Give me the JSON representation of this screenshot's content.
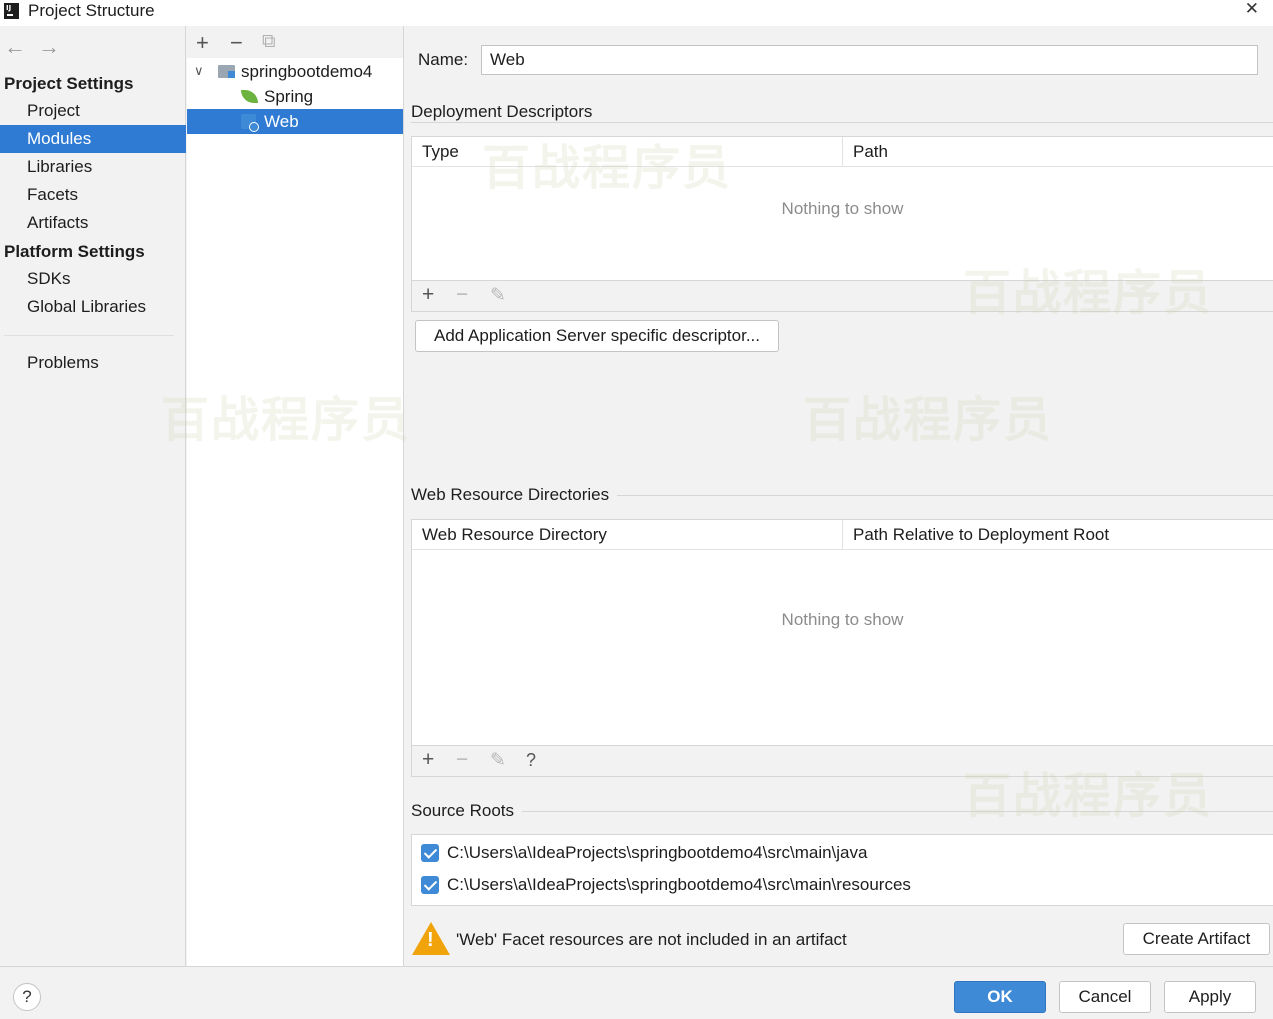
{
  "window": {
    "title": "Project Structure",
    "close_glyph": "✕"
  },
  "sidebar": {
    "back_glyph": "←",
    "forward_glyph": "→",
    "project_settings_label": "Project Settings",
    "project_items": [
      {
        "label": "Project",
        "selected": false
      },
      {
        "label": "Modules",
        "selected": true
      },
      {
        "label": "Libraries",
        "selected": false
      },
      {
        "label": "Facets",
        "selected": false
      },
      {
        "label": "Artifacts",
        "selected": false
      }
    ],
    "platform_settings_label": "Platform Settings",
    "platform_items": [
      {
        "label": "SDKs"
      },
      {
        "label": "Global Libraries"
      }
    ],
    "problems_label": "Problems"
  },
  "tree": {
    "toolbar": {
      "add": "+",
      "remove": "−",
      "copy": "⧉"
    },
    "root": {
      "label": "springbootdemo4",
      "expanded": true,
      "chevron": "∨"
    },
    "children": [
      {
        "label": "Spring",
        "icon": "spring-leaf-icon",
        "selected": false
      },
      {
        "label": "Web",
        "icon": "web-facet-icon",
        "selected": true
      }
    ]
  },
  "main": {
    "name_label": "Name:",
    "name_value": "Web",
    "deployment": {
      "title": "Deployment Descriptors",
      "col_type": "Type",
      "col_path": "Path",
      "empty": "Nothing to show",
      "add_server_button": "Add Application Server specific descriptor..."
    },
    "web_resources": {
      "title": "Web Resource Directories",
      "col_dir": "Web Resource Directory",
      "col_rel": "Path Relative to Deployment Root",
      "empty": "Nothing to show",
      "help_glyph": "?"
    },
    "source_roots": {
      "title": "Source Roots",
      "roots": [
        {
          "path": "C:\\Users\\a\\IdeaProjects\\springbootdemo4\\src\\main\\java",
          "checked": true
        },
        {
          "path": "C:\\Users\\a\\IdeaProjects\\springbootdemo4\\src\\main\\resources",
          "checked": true
        }
      ]
    },
    "warning": {
      "text": "'Web' Facet resources are not included in an artifact",
      "glyph": "!",
      "create_artifact_button": "Create Artifact"
    },
    "toolbar_glyphs": {
      "add": "+",
      "remove": "−",
      "edit": "✎"
    }
  },
  "footer": {
    "help_glyph": "?",
    "ok_label": "OK",
    "cancel_label": "Cancel",
    "apply_label": "Apply"
  },
  "watermark_text": "百战程序员",
  "colors": {
    "selection": "#2f7bd3",
    "primary_button": "#3f8ad6",
    "warning": "#f0a30a",
    "background": "#f2f2f2"
  }
}
